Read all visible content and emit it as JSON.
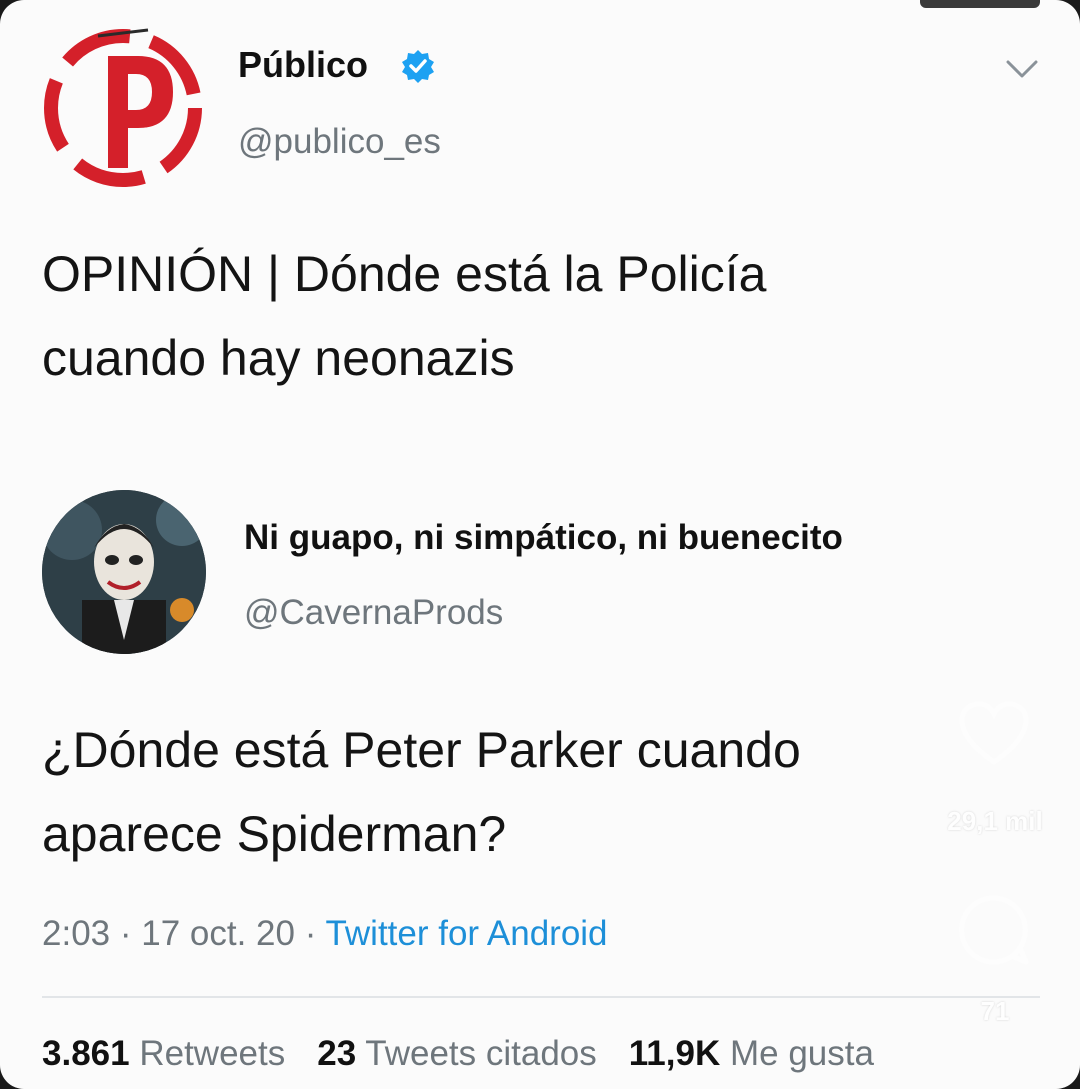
{
  "tweet": {
    "author_name": "Público",
    "author_handle": "@publico_es",
    "text_lines": [
      "OPINIÓN | Dónde está la Policía",
      "cuando hay neonazis"
    ]
  },
  "quoted": {
    "name": "Ni guapo, ni simpático, ni buenecito",
    "handle": "@CavernaProds",
    "text_lines": [
      "¿Dónde está Peter Parker cuando",
      "aparece Spiderman?"
    ]
  },
  "meta": {
    "time": "2:03",
    "sep1": " · ",
    "date": "17 oct. 20",
    "sep2": " · ",
    "client": "Twitter for Android"
  },
  "stats": {
    "retweets_count": "3.861",
    "retweets_label": "Retweets",
    "quotes_count": "23",
    "quotes_label": "Tweets citados",
    "likes_count": "11,9K",
    "likes_label": "Me gusta"
  },
  "overlay": {
    "like_count": "29,1 mil",
    "comment_count": "71"
  },
  "colors": {
    "brand_red": "#d4202a",
    "verified_blue": "#1da1f2",
    "link_blue": "#1d8fd8"
  },
  "icons": [
    "publico-logo",
    "verified-badge-icon",
    "chevron-down-icon",
    "heart-icon",
    "comment-icon"
  ]
}
